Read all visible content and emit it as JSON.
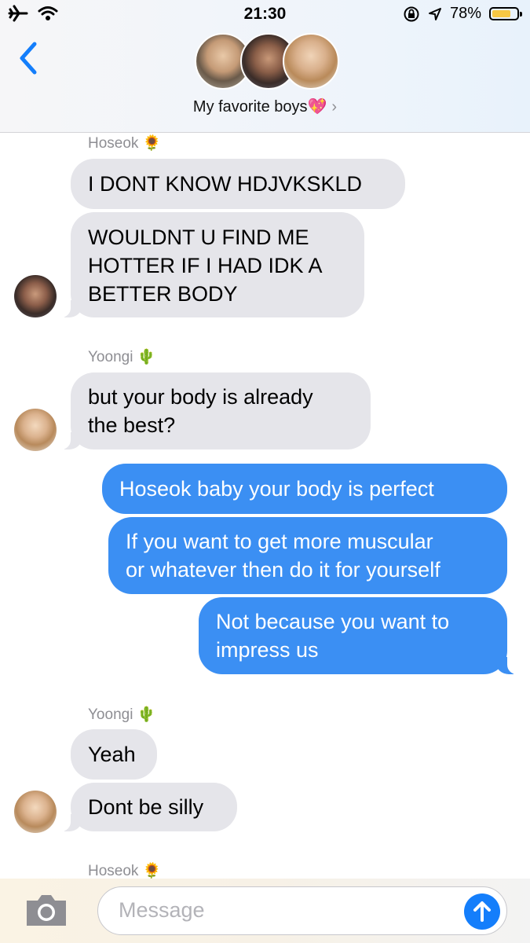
{
  "status": {
    "time": "21:30",
    "battery": "78%",
    "battery_level": 0.78
  },
  "header": {
    "group_name": "My favorite boys💖",
    "chevron": "›"
  },
  "messages": {
    "s1": "Hoseok 🌻",
    "m1": "I DONT KNOW HDJVKSKLD",
    "m2a": "WOULDNT U FIND ME",
    "m2b": "HOTTER IF I HAD IDK A",
    "m2c": "BETTER BODY",
    "s2": "Yoongi 🌵",
    "m3a": "but your body is already",
    "m3b": "the best?",
    "m4": "Hoseok baby your body is perfect",
    "m5a": "If you want to get more muscular",
    "m5b": "or whatever then do it for yourself",
    "m6a": "Not because you want to",
    "m6b": "impress us",
    "s3": "Yoongi 🌵",
    "m7": "Yeah",
    "m8": "Dont be silly",
    "s4": "Hoseok 🌻"
  },
  "input": {
    "placeholder": "Message"
  },
  "colors": {
    "incoming": "#e5e5ea",
    "outgoing": "#3b8ff3",
    "accent": "#147efb"
  },
  "icons": [
    "airplane-icon",
    "wifi-icon",
    "lock-rotation-icon",
    "location-icon",
    "battery-icon",
    "back-chevron-icon",
    "camera-icon",
    "send-arrow-icon"
  ]
}
